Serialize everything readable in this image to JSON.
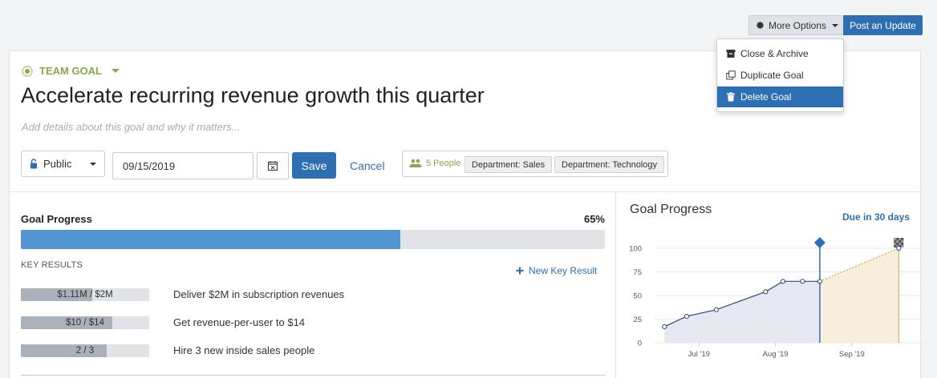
{
  "toolbar": {
    "more_options_label": "More Options",
    "post_update_label": "Post an Update"
  },
  "menu": {
    "items": [
      {
        "label": "Close & Archive",
        "icon": "archive-icon"
      },
      {
        "label": "Duplicate Goal",
        "icon": "duplicate-icon"
      },
      {
        "label": "Delete Goal",
        "icon": "trash-icon",
        "active": true
      }
    ]
  },
  "goal": {
    "type_label": "TEAM GOAL",
    "title": "Accelerate recurring revenue growth this quarter",
    "details_placeholder": "Add details about this goal and why it matters...",
    "visibility": "Public",
    "due_date": "09/15/2019",
    "save_label": "Save",
    "cancel_label": "Cancel",
    "people_label": "5 People",
    "tags": [
      "Department: Sales",
      "Department: Technology"
    ]
  },
  "progress": {
    "label": "Goal Progress",
    "percent_label": "65%",
    "percent": 65
  },
  "key_results": {
    "heading": "KEY RESULTS",
    "new_label": "New Key Result",
    "items": [
      {
        "bar_text": "$1.11M / $2M",
        "fraction": 0.555,
        "label": "Deliver $2M in subscription revenues"
      },
      {
        "bar_text": "$10 / $14",
        "fraction": 0.714,
        "label": "Get revenue-per-user to $14"
      },
      {
        "bar_text": "2 / 3",
        "fraction": 0.667,
        "label": "Hire 3 new inside sales people"
      }
    ]
  },
  "chart_panel": {
    "title": "Goal Progress",
    "due_label": "Due in 30 days"
  },
  "chart_data": {
    "type": "area",
    "y_ticks": [
      0,
      25,
      50,
      75,
      100
    ],
    "ylim": [
      0,
      100
    ],
    "x_tick_labels": [
      "Jul '19",
      "Aug '19",
      "Sep '19"
    ],
    "actual": [
      {
        "x": "2019-06-17",
        "y": 17
      },
      {
        "x": "2019-06-26",
        "y": 28
      },
      {
        "x": "2019-07-08",
        "y": 35
      },
      {
        "x": "2019-07-28",
        "y": 54
      },
      {
        "x": "2019-08-04",
        "y": 65
      },
      {
        "x": "2019-08-12",
        "y": 65
      },
      {
        "x": "2019-08-19",
        "y": 65
      }
    ],
    "projected": [
      {
        "x": "2019-08-19",
        "y": 65
      },
      {
        "x": "2019-09-20",
        "y": 100
      }
    ],
    "today": "2019-08-19",
    "due": "2019-09-20",
    "colors": {
      "actual_line": "#2d4a7a",
      "actual_fill": "#e6e9f2",
      "projected_line": "#d9a347",
      "projected_fill": "#f8eedd",
      "today_marker": "#2e6fb4",
      "due_marker": "#555555"
    }
  },
  "colors": {
    "accent": "#2e6fb4",
    "team_goal": "#8aa84b",
    "progress_fill": "#5195d3"
  }
}
